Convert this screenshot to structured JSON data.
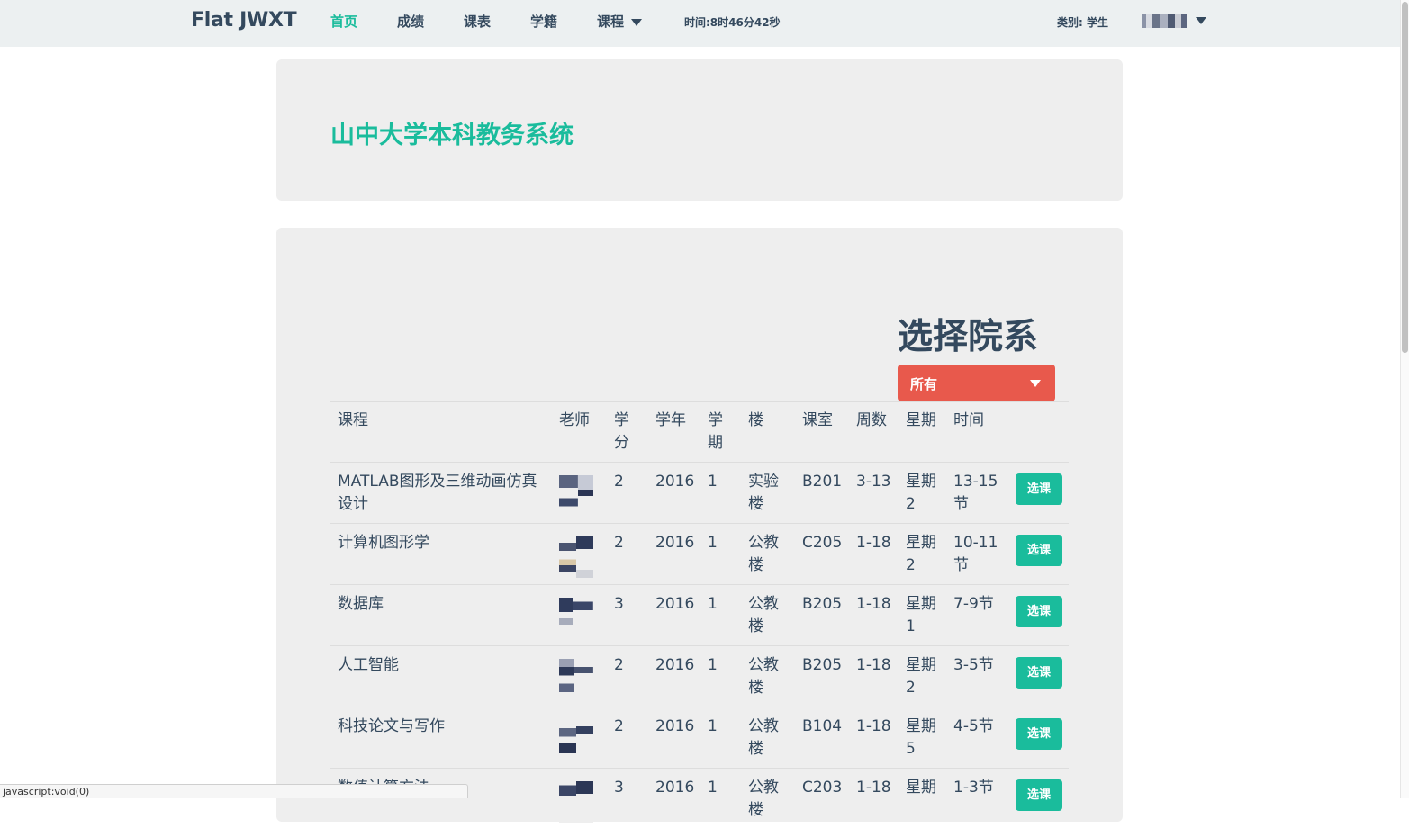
{
  "navbar": {
    "brand": "Flat JWXT",
    "items": [
      {
        "label": "首页",
        "active": true
      },
      {
        "label": "成绩",
        "active": false
      },
      {
        "label": "课表",
        "active": false
      },
      {
        "label": "学籍",
        "active": false
      },
      {
        "label": "课程",
        "active": false,
        "has_dropdown": true
      }
    ],
    "time_text": "时间:8时46分42秒",
    "role_text": "类别: 学生",
    "user_avatar_icon": "pixelated-username",
    "user_dropdown_icon": "caret-down-icon"
  },
  "jumbotron": {
    "title": "山中大学本科教务系统"
  },
  "department": {
    "heading": "选择院系",
    "selected": "所有"
  },
  "table": {
    "headers": [
      "课程",
      "老师",
      "学分",
      "学年",
      "学期",
      "楼",
      "课室",
      "周数",
      "星期",
      "时间",
      ""
    ],
    "rows": [
      {
        "course": "MATLAB图形及三维动画仿真设计",
        "teacher": "",
        "credit": "2",
        "year": "2016",
        "term": "1",
        "building": "实验楼",
        "room": "B201",
        "weeks": "3-13",
        "weekday": "星期2",
        "time": "13-15节",
        "action": "选课"
      },
      {
        "course": "计算机图形学",
        "teacher": "",
        "credit": "2",
        "year": "2016",
        "term": "1",
        "building": "公教楼",
        "room": "C205",
        "weeks": "1-18",
        "weekday": "星期2",
        "time": "10-11节",
        "action": "选课"
      },
      {
        "course": "数据库",
        "teacher": "",
        "credit": "3",
        "year": "2016",
        "term": "1",
        "building": "公教楼",
        "room": "B205",
        "weeks": "1-18",
        "weekday": "星期1",
        "time": "7-9节",
        "action": "选课"
      },
      {
        "course": "人工智能",
        "teacher": "",
        "credit": "2",
        "year": "2016",
        "term": "1",
        "building": "公教楼",
        "room": "B205",
        "weeks": "1-18",
        "weekday": "星期2",
        "time": "3-5节",
        "action": "选课"
      },
      {
        "course": "科技论文与写作",
        "teacher": "",
        "credit": "2",
        "year": "2016",
        "term": "1",
        "building": "公教楼",
        "room": "B104",
        "weeks": "1-18",
        "weekday": "星期5",
        "time": "4-5节",
        "action": "选课"
      },
      {
        "course": "数值计算方法",
        "teacher": "",
        "credit": "3",
        "year": "2016",
        "term": "1",
        "building": "公教楼",
        "room": "C203",
        "weeks": "1-18",
        "weekday": "星期",
        "time": "1-3节",
        "action": "选课"
      }
    ]
  },
  "status_bar": {
    "text": "javascript:void(0)"
  },
  "colors": {
    "accent": "#1abc9c",
    "dropdown": "#e8594c",
    "text": "#34495e",
    "panel_bg": "#eeeeee",
    "navbar_bg": "#ecf0f1"
  }
}
